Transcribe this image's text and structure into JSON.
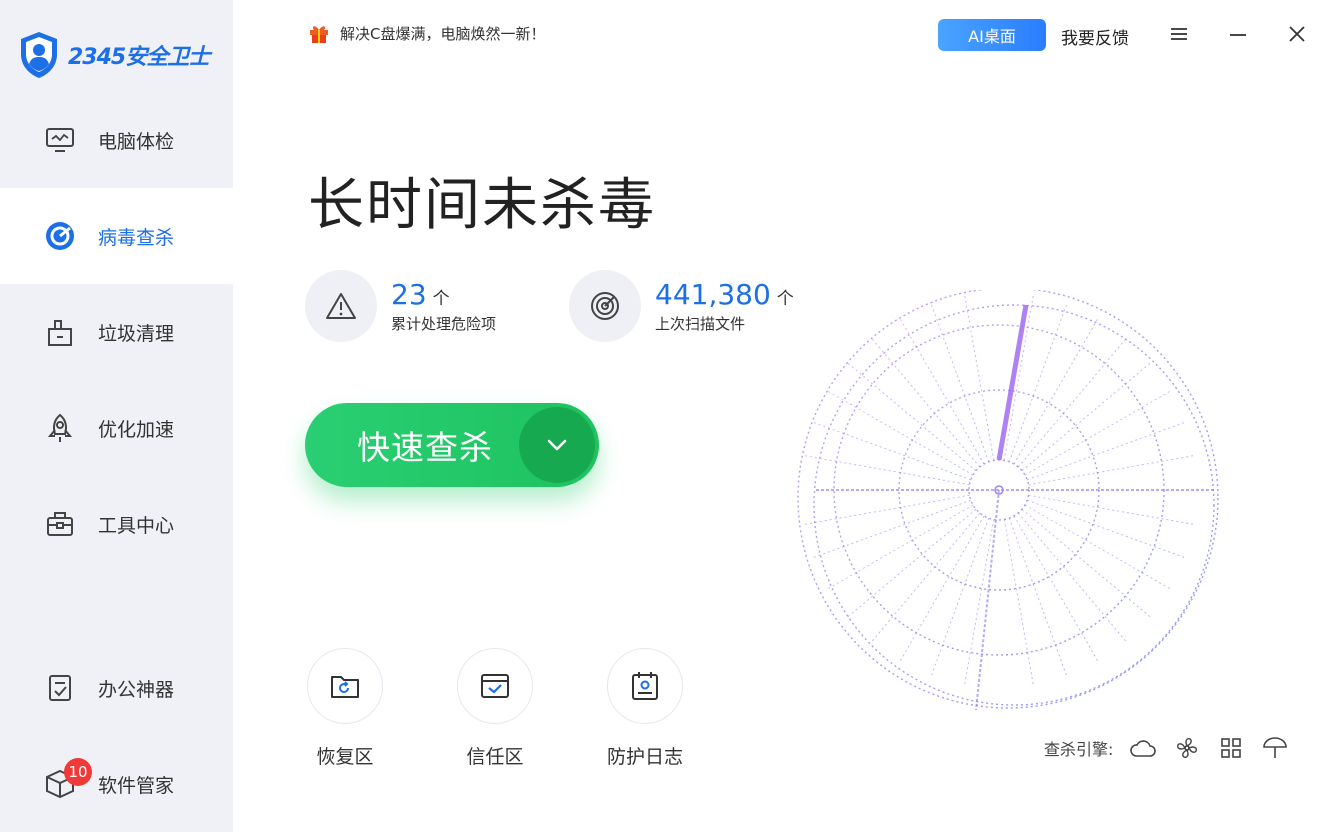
{
  "app": {
    "name": "2345安全卫士"
  },
  "sidebar": {
    "items": [
      {
        "label": "电脑体检",
        "icon": "monitor-icon"
      },
      {
        "label": "病毒查杀",
        "icon": "target-icon",
        "active": true
      },
      {
        "label": "垃圾清理",
        "icon": "trash-icon"
      },
      {
        "label": "优化加速",
        "icon": "rocket-icon"
      },
      {
        "label": "工具中心",
        "icon": "toolbox-icon"
      },
      {
        "label": "办公神器",
        "icon": "clipboard-icon"
      },
      {
        "label": "软件管家",
        "icon": "box-icon",
        "badge": "10"
      }
    ]
  },
  "topbar": {
    "promo_text": "解决C盘爆满，电脑焕然一新！",
    "ai_button": "AI桌面",
    "feedback": "我要反馈"
  },
  "main": {
    "headline": "长时间未杀毒",
    "stats": [
      {
        "value": "23",
        "unit": "个",
        "label": "累计处理危险项",
        "icon": "warning-icon"
      },
      {
        "value": "441,380",
        "unit": "个",
        "label": "上次扫描文件",
        "icon": "target-icon"
      }
    ],
    "scan_button": "快速查杀",
    "tools": [
      {
        "label": "恢复区",
        "icon": "folder-restore-icon"
      },
      {
        "label": "信任区",
        "icon": "trust-check-icon"
      },
      {
        "label": "防护日志",
        "icon": "calendar-log-icon"
      }
    ],
    "engine_label": "查杀引擎:"
  },
  "colors": {
    "accent": "#1d6fe8",
    "scan_green": "#1ec25f",
    "sidebar_bg": "#f0f1f6",
    "badge_red": "#f03a3a"
  }
}
